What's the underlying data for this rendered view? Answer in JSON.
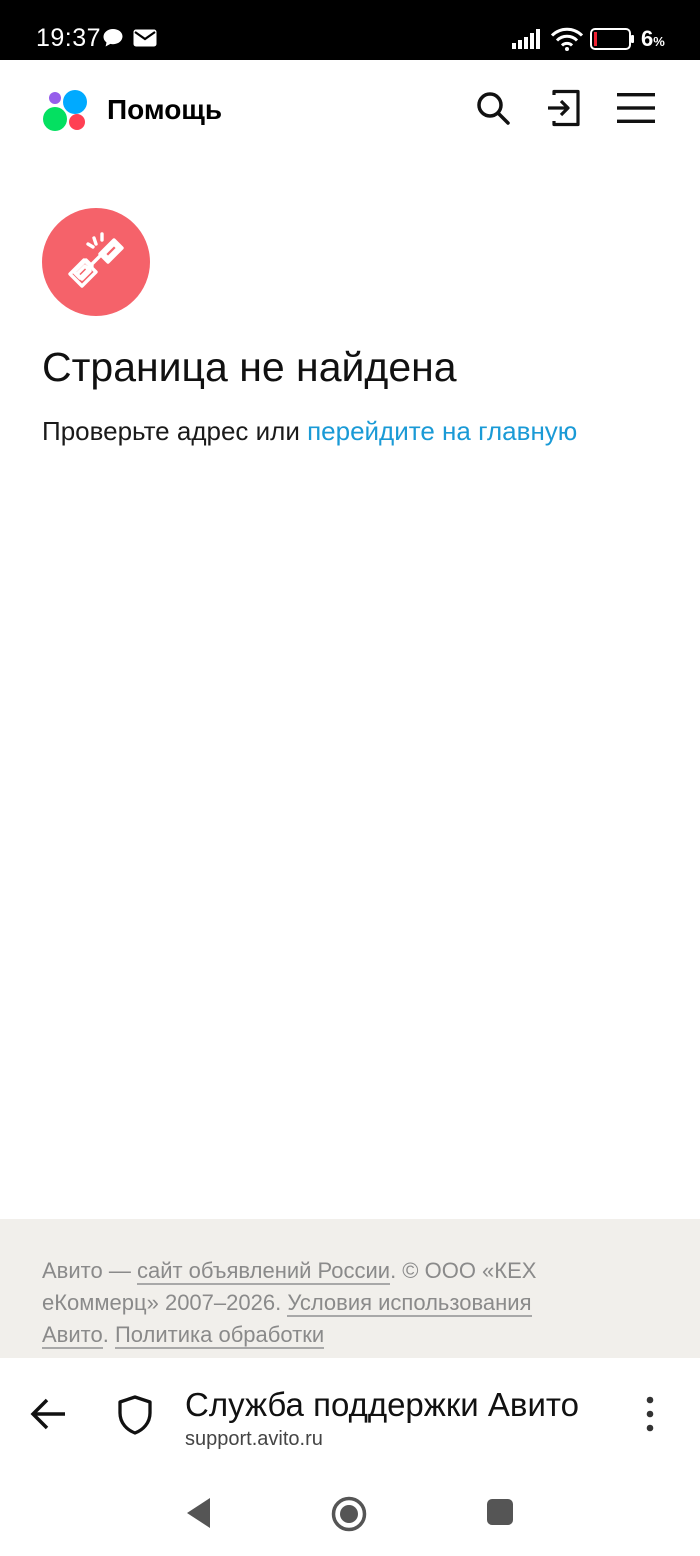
{
  "status_bar": {
    "time": "19:37",
    "battery_percent": "6",
    "battery_suffix": "%",
    "icons": [
      "chat-bubble-icon",
      "mail-icon",
      "signal-icon",
      "wifi-icon",
      "battery-icon"
    ]
  },
  "header": {
    "title": "Помощь",
    "icons": [
      "search-icon",
      "login-icon",
      "menu-icon"
    ],
    "logo_colors": [
      "#965eeb",
      "#0af",
      "#04e061",
      "#ff4053"
    ]
  },
  "error": {
    "icon": "broken-link-icon",
    "icon_bg": "#f5626a",
    "title": "Страница не найдена",
    "text": "Проверьте адрес или ",
    "link": "перейдите на главную",
    "link_color": "#1a9ad6"
  },
  "footer": {
    "text_1": "Авито — ",
    "link_1": "сайт объявлений России",
    "text_2": ". © ООО «КЕХ еКоммерц» 2007–2026. ",
    "link_2": "Условия использования Авито",
    "text_3": ". ",
    "link_3": "Политика обработки"
  },
  "browser_bar": {
    "title": "Служба поддержки Авито",
    "url": "support.avito.ru",
    "icons": [
      "back-arrow-icon",
      "shield-icon",
      "more-vert-icon"
    ]
  },
  "system_nav": {
    "icons": [
      "nav-back-icon",
      "nav-home-icon",
      "nav-recents-icon"
    ]
  }
}
